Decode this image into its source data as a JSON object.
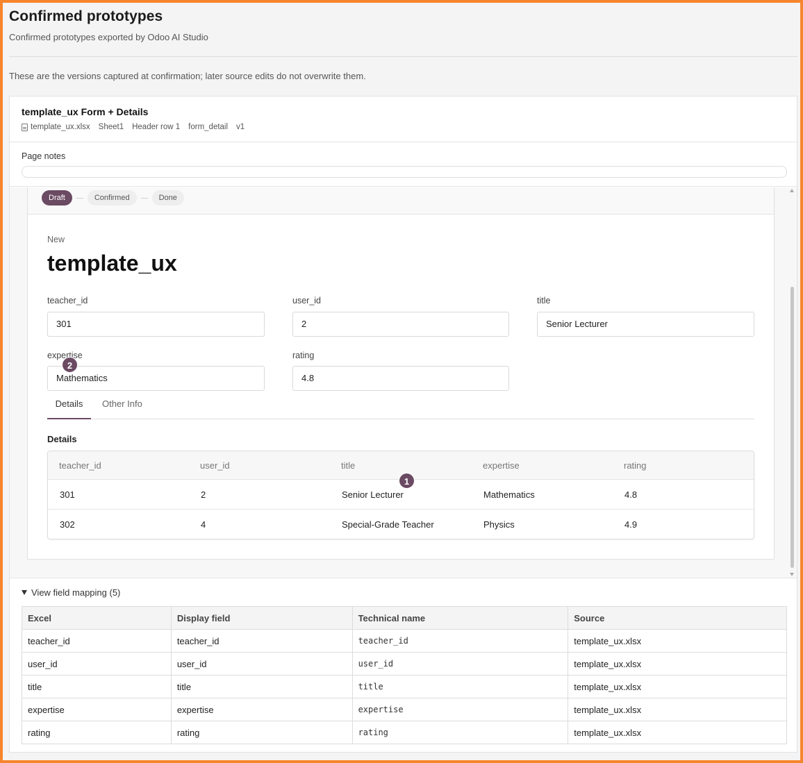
{
  "page": {
    "title": "Confirmed prototypes",
    "subtitle": "Confirmed prototypes exported by Odoo AI Studio",
    "note": "These are the versions captured at confirmation; later source edits do not overwrite them."
  },
  "prototype": {
    "title": "template_ux Form + Details",
    "meta": {
      "file": "template_ux.xlsx",
      "sheet": "Sheet1",
      "header_row": "Header row 1",
      "view": "form_detail",
      "version": "v1"
    },
    "page_notes_label": "Page notes",
    "page_notes_value": ""
  },
  "form": {
    "statusbar": [
      {
        "label": "Draft",
        "active": true
      },
      {
        "label": "Confirmed",
        "active": false
      },
      {
        "label": "Done",
        "active": false
      }
    ],
    "record_state": "New",
    "record_title": "template_ux",
    "fields": {
      "teacher_id": {
        "label": "teacher_id",
        "value": "301"
      },
      "user_id": {
        "label": "user_id",
        "value": "2"
      },
      "title": {
        "label": "title",
        "value": "Senior Lecturer"
      },
      "expertise": {
        "label": "expertise",
        "value": "Mathematics"
      },
      "rating": {
        "label": "rating",
        "value": "4.8"
      }
    },
    "badges": {
      "one": "1",
      "two": "2"
    },
    "tabs": [
      "Details",
      "Other Info"
    ],
    "active_tab": "Details",
    "section_title": "Details",
    "detail_table": {
      "columns": [
        "teacher_id",
        "user_id",
        "title",
        "expertise",
        "rating"
      ],
      "rows": [
        [
          "301",
          "2",
          "Senior Lecturer",
          "Mathematics",
          "4.8"
        ],
        [
          "302",
          "4",
          "Special-Grade Teacher",
          "Physics",
          "4.9"
        ]
      ]
    }
  },
  "mapping": {
    "toggle_label": "View field mapping (5)",
    "columns": [
      "Excel",
      "Display field",
      "Technical name",
      "Source"
    ],
    "rows": [
      [
        "teacher_id",
        "teacher_id",
        "teacher_id",
        "template_ux.xlsx"
      ],
      [
        "user_id",
        "user_id",
        "user_id",
        "template_ux.xlsx"
      ],
      [
        "title",
        "title",
        "title",
        "template_ux.xlsx"
      ],
      [
        "expertise",
        "expertise",
        "expertise",
        "template_ux.xlsx"
      ],
      [
        "rating",
        "rating",
        "rating",
        "template_ux.xlsx"
      ]
    ]
  },
  "icons": {
    "file": "file-icon",
    "toggle": "triangle-down-icon",
    "scroll_up": "scroll-up-arrow-icon",
    "scroll_down": "scroll-down-arrow-icon"
  },
  "colors": {
    "accent": "#6b4a63",
    "frame": "#f6852e"
  }
}
